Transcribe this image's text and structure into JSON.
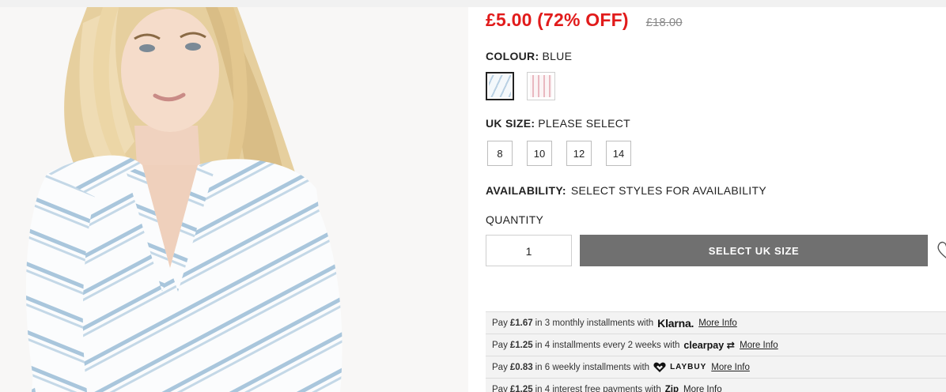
{
  "price": {
    "current": "£5.00 (72% OFF)",
    "original": "£18.00"
  },
  "colour": {
    "label": "COLOUR:",
    "value": "BLUE",
    "swatches": [
      {
        "name": "blue-stripe",
        "selected": true,
        "color": "#b9d0e3"
      },
      {
        "name": "pink-stripe",
        "selected": false,
        "color": "#e9b8c0"
      }
    ]
  },
  "size": {
    "label": "UK SIZE:",
    "value": "PLEASE SELECT",
    "options": [
      "8",
      "10",
      "12",
      "14"
    ]
  },
  "availability": {
    "label": "AVAILABILITY:",
    "value": "SELECT STYLES FOR AVAILABILITY"
  },
  "quantity": {
    "label": "QUANTITY",
    "value": "1"
  },
  "cta": {
    "label": "SELECT UK SIZE",
    "color": "#707070"
  },
  "payments": [
    {
      "prefix": "Pay",
      "amount": "£1.67",
      "text": "in 3 monthly installments with",
      "brand": "Klarna.",
      "link": "More Info"
    },
    {
      "prefix": "Pay",
      "amount": "£1.25",
      "text": "in 4 installments every 2 weeks with",
      "brand": "clearpay",
      "link": "More Info"
    },
    {
      "prefix": "Pay",
      "amount": "£0.83",
      "text": "in 6 weekly installments with",
      "brand_light": "LAY",
      "brand_bold": "BUY",
      "link": "More Info"
    },
    {
      "prefix": "Pay",
      "amount": "£1.25",
      "text": "in 4 interest free payments with",
      "brand": "Zip",
      "link": "More Info"
    }
  ],
  "colors": {
    "sale_price": "#e11b1b",
    "accent_dark": "#222222"
  }
}
